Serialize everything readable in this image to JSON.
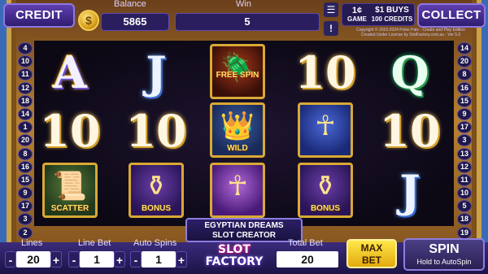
{
  "header": {
    "credit_label": "CREDIT",
    "balance_label": "Balance",
    "balance_value": "5865",
    "win_label": "Win",
    "win_value": "5",
    "denom_amount": "1¢",
    "denom_unit": "GAME",
    "buys_label": "$1 BUYS",
    "buys_credits": "100 CREDITS",
    "collect_label": "COLLECT",
    "menu_icon": "hamburger-icon",
    "info_icon": "info-icon",
    "coin_icon": "dollar-coin-icon",
    "copyright_line1": "Copyright © 2023-2024 Pokie Pals - Create and Play Edition",
    "copyright_line2": "Created Under License by SlotFactory.com.au - Ver 5.0"
  },
  "paylines_left": [
    "4",
    "10",
    "11",
    "12",
    "18",
    "14",
    "1",
    "20",
    "8",
    "16",
    "15",
    "9",
    "17",
    "3",
    "2"
  ],
  "paylines_right": [
    "14",
    "20",
    "8",
    "16",
    "15",
    "9",
    "17",
    "3",
    "13",
    "12",
    "11",
    "10",
    "5",
    "18",
    "19"
  ],
  "reels": [
    [
      {
        "type": "letter",
        "text": "A"
      },
      {
        "type": "letter",
        "text": "10"
      },
      {
        "type": "tile",
        "name": "scatter",
        "label": "SCATTER"
      }
    ],
    [
      {
        "type": "letter",
        "text": "J"
      },
      {
        "type": "letter",
        "text": "10"
      },
      {
        "type": "tile",
        "name": "bonus",
        "label": "BONUS"
      }
    ],
    [
      {
        "type": "tile",
        "name": "free-spin",
        "label": "FREE SPIN"
      },
      {
        "type": "tile",
        "name": "cleopatra",
        "label": "WILD"
      },
      {
        "type": "tile",
        "name": "ankh-purple",
        "label": ""
      }
    ],
    [
      {
        "type": "letter",
        "text": "10"
      },
      {
        "type": "tile",
        "name": "ankh-blue",
        "label": ""
      },
      {
        "type": "tile",
        "name": "bonus",
        "label": "BONUS"
      }
    ],
    [
      {
        "type": "letter",
        "text": "Q"
      },
      {
        "type": "letter",
        "text": "10"
      },
      {
        "type": "letter",
        "text": "J"
      }
    ]
  ],
  "title_plate": {
    "line1": "EGYPTIAN DREAMS",
    "line2": "SLOT CREATOR"
  },
  "footer": {
    "lines_label": "Lines",
    "lines_value": "20",
    "linebet_label": "Line Bet",
    "linebet_value": "1",
    "autospins_label": "Auto Spins",
    "autospins_value": "1",
    "minus": "-",
    "plus": "+",
    "totalbet_label": "Total Bet",
    "totalbet_value": "20",
    "maxbet_line1": "MAX",
    "maxbet_line2": "BET",
    "spin_label": "SPIN",
    "spin_sub": "Hold to AutoSpin",
    "logo_line1": "SLOT",
    "logo_line2": "FACTORY"
  }
}
